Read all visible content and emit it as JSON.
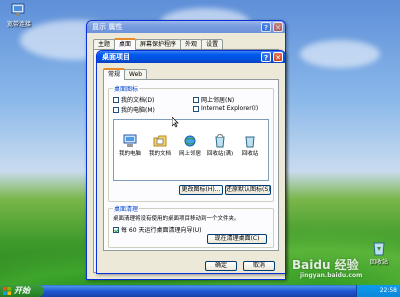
{
  "desktop": {
    "icon_broadband": "宽带连接",
    "icon_recycle": "回收站"
  },
  "display_properties": {
    "title": "显示 属性",
    "tabs": [
      "主题",
      "桌面",
      "屏幕保护程序",
      "外观",
      "设置"
    ]
  },
  "desktop_items": {
    "title": "桌面项目",
    "help_btn": "?",
    "close_btn": "✕",
    "tabs": [
      "常规",
      "Web"
    ],
    "icons_group_title": "桌面图标",
    "checkboxes": [
      {
        "label": "我的文档(D)",
        "checked": false
      },
      {
        "label": "网上邻居(N)",
        "checked": false
      },
      {
        "label": "我的电脑(M)",
        "checked": false
      },
      {
        "label": "Internet Explorer(I)",
        "checked": false
      }
    ],
    "icon_list": [
      "我的电脑",
      "我的文档",
      "网上邻居",
      "回收站(满)",
      "回收站"
    ],
    "change_icon_btn": "更改图标(H)...",
    "restore_default_btn": "还原默认图标(S)",
    "cleanup_group_title": "桌面清理",
    "cleanup_text": "桌面清理将没有使用的桌面项目移动到一个文件夹。",
    "cleanup_checkbox": "每 60 天运行桌面清理向导(U)",
    "cleanup_checked": true,
    "cleanup_now_btn": "现在清理桌面(C)",
    "ok_btn": "确定",
    "cancel_btn": "取消"
  },
  "taskbar": {
    "start": "开始",
    "clock": "22:58"
  },
  "watermark": {
    "text": "Baidu 经验",
    "url": "jingyan.baidu.com"
  },
  "colors": {
    "title_active": "#0058ee",
    "window_bg": "#ece9d8",
    "taskbar": "#2157d7",
    "start_green": "#2e8b2e"
  }
}
